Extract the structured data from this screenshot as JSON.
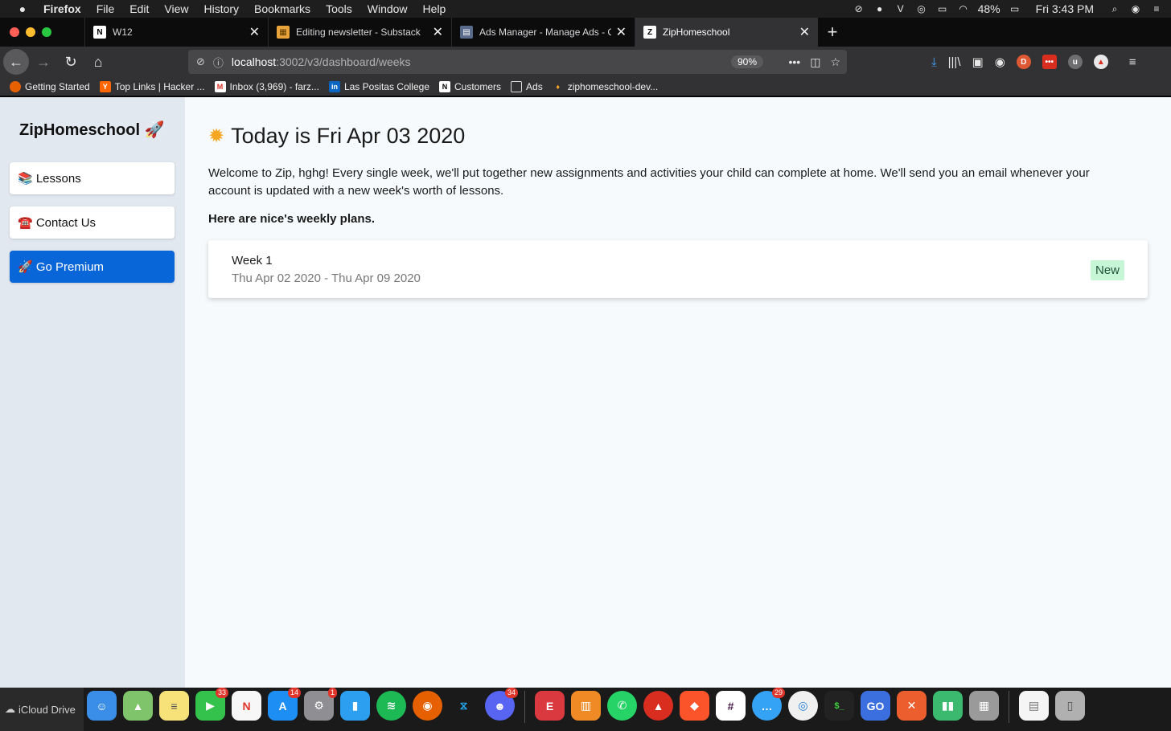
{
  "menubar": {
    "app": "Firefox",
    "items": [
      "File",
      "Edit",
      "View",
      "History",
      "Bookmarks",
      "Tools",
      "Window",
      "Help"
    ],
    "battery": "48%",
    "clock": "Fri 3:43 PM"
  },
  "tabs": [
    {
      "label": "W12",
      "fav": "N",
      "fav_color": "#000000"
    },
    {
      "label": "Editing newsletter - Substack",
      "fav": "▦",
      "fav_color": "#e8a33b"
    },
    {
      "label": "Ads Manager - Manage Ads - C",
      "fav": "▤",
      "fav_color": "#5a6b8c"
    },
    {
      "label": "ZipHomeschool",
      "fav": "Z",
      "fav_color": "#000000"
    }
  ],
  "url": {
    "host": "localhost",
    "path": ":3002/v3/dashboard/weeks",
    "zoom": "90%"
  },
  "bookmarks": [
    {
      "label": "Getting Started",
      "fav": "●",
      "color": "#e66000"
    },
    {
      "label": "Top Links | Hacker ...",
      "fav": "Y",
      "color": "#ff6600"
    },
    {
      "label": "Inbox (3,969) - farz...",
      "fav": "M",
      "color": "#d93025"
    },
    {
      "label": "Las Positas College",
      "fav": "in",
      "color": "#0a66c2"
    },
    {
      "label": "Customers",
      "fav": "N",
      "color": "#000000"
    },
    {
      "label": "Ads",
      "fav": "▭",
      "color": "#323234"
    },
    {
      "label": "ziphomeschool-dev...",
      "fav": "♦",
      "color": "#f5a623"
    }
  ],
  "sidebar": {
    "brand": "ZipHomeschool 🚀",
    "items": [
      {
        "label": "📚 Lessons"
      },
      {
        "label": "☎️ Contact Us"
      },
      {
        "label": "🚀 Go Premium"
      }
    ]
  },
  "main": {
    "today": "Today is Fri Apr 03 2020",
    "welcome": "Welcome to Zip, hghg! Every single week, we'll put together new assignments and activities your child can complete at home. We'll send you an email whenever your account is updated with a new week's worth of lessons.",
    "plans_heading": "Here are nice's weekly plans.",
    "weeks": [
      {
        "title": "Week 1",
        "range": "Thu Apr 02 2020 - Thu Apr 09 2020",
        "badge": "New"
      }
    ]
  },
  "dock": {
    "finder_label": "iCloud Drive",
    "badges": {
      "facetime": "33",
      "appstore": "14",
      "settings": "1",
      "discord": "34",
      "messages": "29"
    }
  }
}
